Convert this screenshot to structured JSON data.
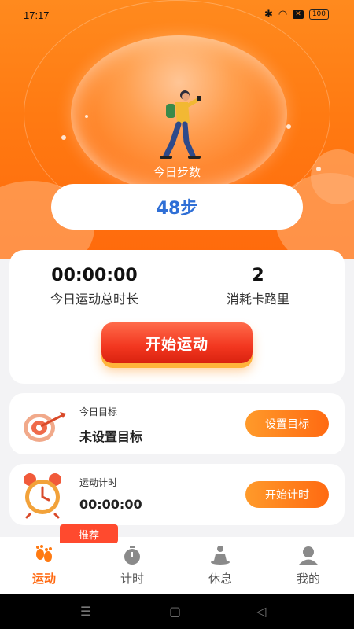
{
  "status_bar": {
    "time": "17:17",
    "battery": "100",
    "icons": [
      "bluetooth-icon",
      "wifi-icon",
      "x-icon",
      "battery-icon"
    ]
  },
  "hero": {
    "steps_label": "今日步数",
    "steps_value": "48步"
  },
  "stats": {
    "duration_value": "00:00:00",
    "duration_label": "今日运动总时长",
    "calories_value": "2",
    "calories_label": "消耗卡路里",
    "start_button": "开始运动"
  },
  "goal": {
    "title": "今日目标",
    "value": "未设置目标",
    "button": "设置目标",
    "icon": "target-icon"
  },
  "timer": {
    "title": "运动计时",
    "value": "00:00:00",
    "button": "开始计时",
    "icon": "alarm-clock-icon"
  },
  "tabbar": {
    "badge": "推荐",
    "tabs": [
      {
        "label": "运动",
        "icon": "footprints-icon",
        "active": true
      },
      {
        "label": "计时",
        "icon": "stopwatch-icon",
        "active": false
      },
      {
        "label": "休息",
        "icon": "meditation-icon",
        "active": false
      },
      {
        "label": "我的",
        "icon": "profile-icon",
        "active": false
      }
    ]
  },
  "colors": {
    "accent": "#ff7a12",
    "steps_text": "#2f6fd6",
    "start_button": "#f2361f"
  }
}
